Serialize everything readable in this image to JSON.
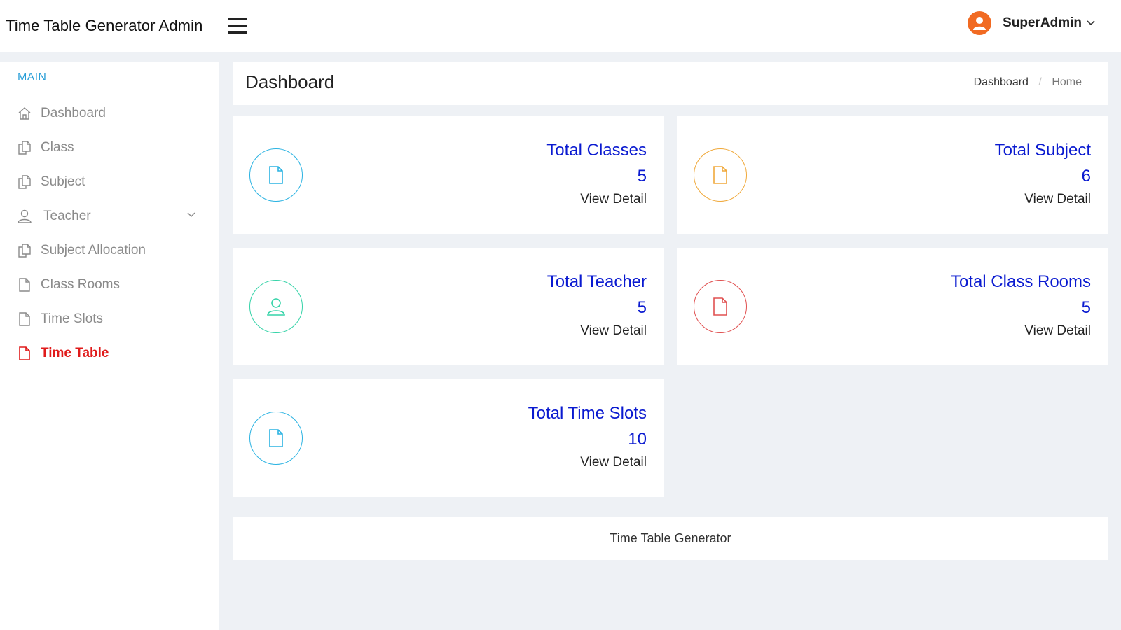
{
  "app": {
    "title": "Time Table Generator Admin"
  },
  "user": {
    "name": "SuperAdmin"
  },
  "sidebar": {
    "section": "MAIN",
    "items": [
      {
        "label": "Dashboard",
        "icon": "home-icon"
      },
      {
        "label": "Class",
        "icon": "copy-icon"
      },
      {
        "label": "Subject",
        "icon": "copy-icon"
      },
      {
        "label": "Teacher",
        "icon": "user-icon"
      },
      {
        "label": "Subject Allocation",
        "icon": "copy-icon"
      },
      {
        "label": "Class Rooms",
        "icon": "file-icon"
      },
      {
        "label": "Time Slots",
        "icon": "file-icon"
      },
      {
        "label": "Time Table",
        "icon": "file-icon",
        "active": true
      }
    ]
  },
  "page": {
    "title": "Dashboard",
    "breadcrumb": {
      "link": "Dashboard",
      "current": "Home"
    }
  },
  "cards": [
    {
      "title": "Total Classes",
      "value": "5",
      "link": "View Detail",
      "color": "#2bb3e2",
      "icon": "file-icon"
    },
    {
      "title": "Total Subject",
      "value": "6",
      "link": "View Detail",
      "color": "#f0a93b",
      "icon": "file-icon"
    },
    {
      "title": "Total Teacher",
      "value": "5",
      "link": "View Detail",
      "color": "#35d3a8",
      "icon": "user-icon"
    },
    {
      "title": "Total Class Rooms",
      "value": "5",
      "link": "View Detail",
      "color": "#e05050",
      "icon": "file-icon"
    },
    {
      "title": "Total Time Slots",
      "value": "10",
      "link": "View Detail",
      "color": "#2bb3e2",
      "icon": "file-icon"
    }
  ],
  "footer": {
    "text": "Time Table Generator"
  },
  "colors": {
    "accent_blue": "#0a1ad0",
    "active_red": "#e01b1b",
    "section_blue": "#2a9fd8",
    "avatar": "#f16a22"
  }
}
